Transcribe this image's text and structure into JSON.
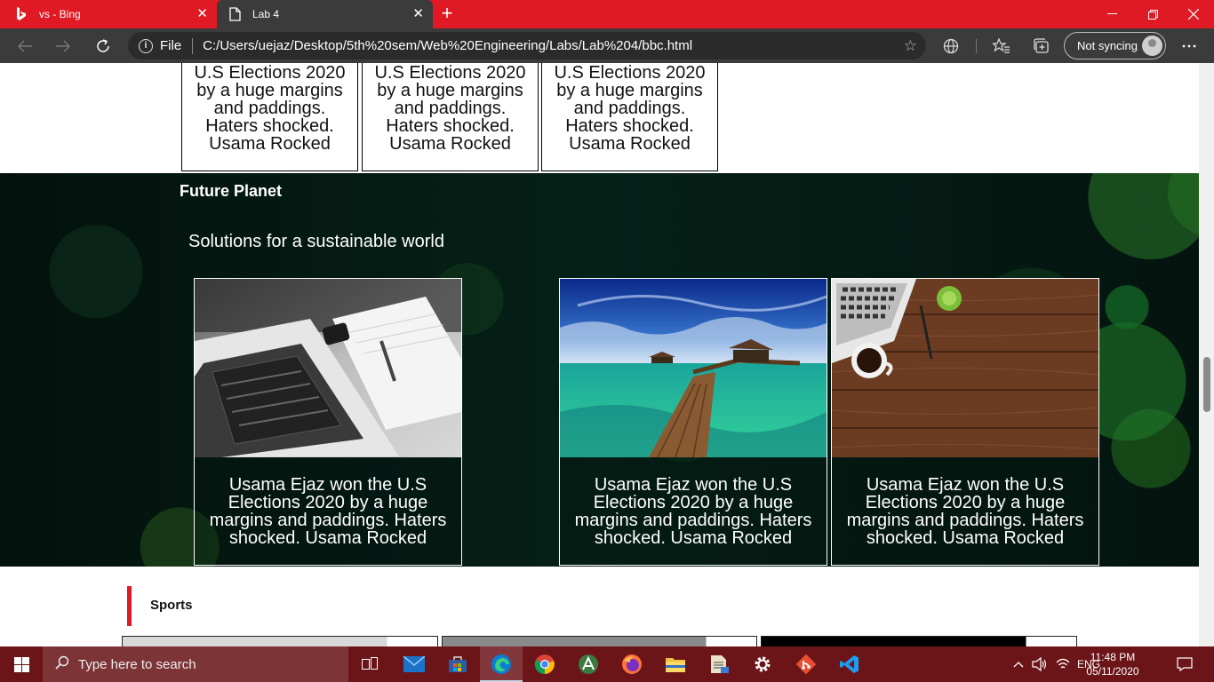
{
  "browser": {
    "tabs": [
      {
        "title": "vs - Bing",
        "active": false
      },
      {
        "title": "Lab 4",
        "active": true
      }
    ],
    "address": {
      "scheme": "File",
      "url": "C:/Users/uejaz/Desktop/5th%20sem/Web%20Engineering/Labs/Lab%204/bbc.html"
    },
    "sync_label": "Not syncing"
  },
  "page": {
    "top_cards": [
      {
        "text": "U.S Elections 2020 by a huge margins and paddings. Haters shocked. Usama Rocked"
      },
      {
        "text": "U.S Elections 2020 by a huge margins and paddings. Haters shocked. Usama Rocked"
      },
      {
        "text": "U.S Elections 2020 by a huge margins and paddings. Haters shocked. Usama Rocked"
      }
    ],
    "future_planet": {
      "title": "Future Planet",
      "subtitle": "Solutions for a sustainable world",
      "cards": [
        {
          "image": "laptop-notebook-image",
          "caption": "Usama Ejaz won the U.S Elections 2020 by a huge margins and paddings. Haters shocked. Usama Rocked"
        },
        {
          "image": "tropical-pier-image",
          "caption": "Usama Ejaz won the U.S Elections 2020 by a huge margins and paddings. Haters shocked. Usama Rocked"
        },
        {
          "image": "desk-coffee-image",
          "caption": "Usama Ejaz won the U.S Elections 2020 by a huge margins and paddings. Haters shocked. Usama Rocked"
        }
      ]
    },
    "sports": {
      "title": "Sports"
    }
  },
  "taskbar": {
    "search_placeholder": "Type here to search",
    "apps": [
      "task-view-icon",
      "mail-icon",
      "store-icon",
      "edge-icon",
      "chrome-icon",
      "android-studio-icon",
      "firefox-icon",
      "file-explorer-icon",
      "file-manager-icon",
      "settings-icon",
      "git-icon",
      "vscode-icon"
    ],
    "language": "ENG",
    "time": "11:48 PM",
    "date": "05/11/2020"
  },
  "colors": {
    "tab_strip": "#e01a24",
    "toolbar": "#3b3b3b",
    "taskbar": "#6b1519",
    "future_bg": "#052118",
    "sports_accent": "#e01a24"
  }
}
